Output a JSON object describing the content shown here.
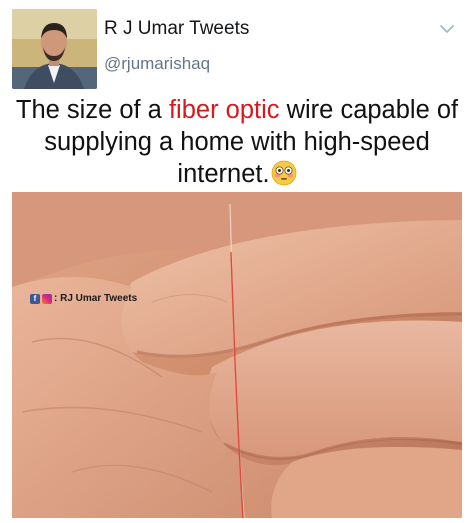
{
  "tweet": {
    "author_name": "R J Umar Tweets",
    "handle": "@rjumarishaq",
    "caption_before": "The size of a ",
    "caption_highlight": "fiber optic",
    "caption_after": " wire capable of supplying a home with high-speed internet.",
    "caption_highlight_color": "#d7181c",
    "emoji": "flushed-face",
    "menu_icon": "chevron-down-icon"
  },
  "image": {
    "subject": "fiber optic strand lying across a palm",
    "watermark_text": ": RJ Umar Tweets",
    "watermark_icons": [
      "facebook-icon",
      "instagram-icon"
    ]
  }
}
